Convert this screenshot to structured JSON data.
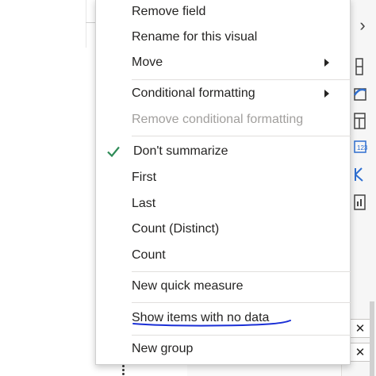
{
  "menu": {
    "items": [
      {
        "label": "Remove field"
      },
      {
        "label": "Rename for this visual"
      },
      {
        "label": "Move"
      },
      {
        "label": "Conditional formatting"
      },
      {
        "label": "Remove conditional formatting"
      },
      {
        "label": "Don't summarize"
      },
      {
        "label": "First"
      },
      {
        "label": "Last"
      },
      {
        "label": "Count (Distinct)"
      },
      {
        "label": "Count"
      },
      {
        "label": "New quick measure"
      },
      {
        "label": "Show items with no data"
      },
      {
        "label": "New group"
      }
    ]
  },
  "icons": {
    "check": "check-icon",
    "submenu": "chevron-right-icon",
    "pane_expand": "chevron-right-icon",
    "more": "more-vertical-icon",
    "close": "close-icon"
  },
  "glyphs": {
    "pane_chevron": "›",
    "close": "✕"
  },
  "colors": {
    "check": "#2e8b57",
    "annotation": "#1a2fd6",
    "disabled_text": "#a19f9d"
  }
}
